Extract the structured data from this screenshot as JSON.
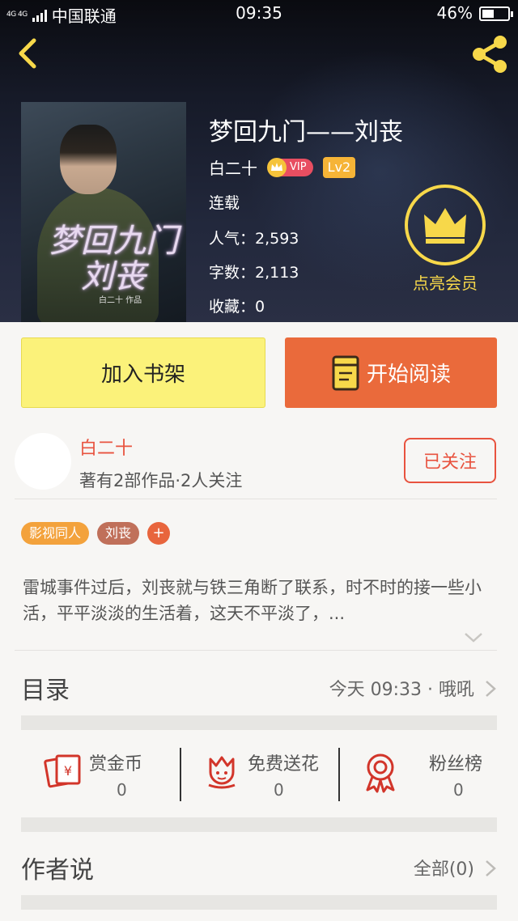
{
  "status_bar": {
    "network": "4G 4G",
    "carrier": "中国联通",
    "time": "09:35",
    "battery": "46%",
    "battery_level": 0.46
  },
  "book": {
    "title": "梦回九门——刘丧",
    "author": "白二十",
    "vip_label": "VIP",
    "level": "Lv2",
    "status": "连载",
    "popularity": "人气：2,593",
    "word_count": "字数：2,113",
    "favorites": "收藏：0",
    "cover_title": "梦回九门 刘丧",
    "cover_author": "白二十 作品"
  },
  "member": {
    "label": "点亮会员"
  },
  "actions": {
    "add_shelf": "加入书架",
    "start_reading": "开始阅读"
  },
  "author_card": {
    "name": "白二十",
    "stats": "著有2部作品·2人关注",
    "follow_label": "已关注"
  },
  "tags": [
    {
      "label": "影视同人",
      "color": "#f3a23c"
    },
    {
      "label": "刘丧",
      "color": "#c0705a"
    }
  ],
  "tag_add": "+",
  "summary": "雷城事件过后，刘丧就与铁三角断了联系，时不时的接一些小活，平平淡淡的生活着，这天不平淡了，...",
  "catalog": {
    "label": "目录",
    "value": "今天 09:33 · 哦吼"
  },
  "rewards": [
    {
      "label": "赏金币",
      "count": "0",
      "icon": "coin-envelope-icon"
    },
    {
      "label": "免费送花",
      "count": "0",
      "icon": "flower-icon"
    },
    {
      "label": "粉丝榜",
      "count": "0",
      "icon": "rosette-icon"
    }
  ],
  "author_says": {
    "label": "作者说",
    "value": "全部(0)"
  },
  "colors": {
    "accent_orange": "#ea6a3b",
    "accent_red": "#e8533f",
    "accent_yellow": "#fbf27a",
    "gold": "#f7d84a"
  }
}
